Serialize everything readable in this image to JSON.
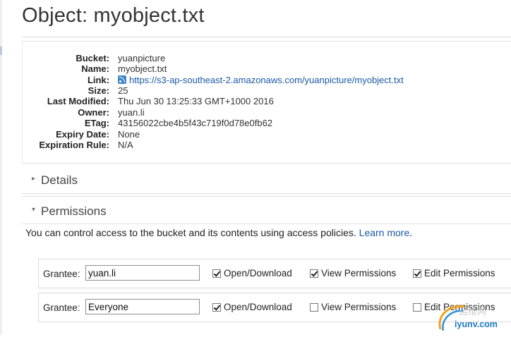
{
  "page": {
    "title": "Object: myobject.txt"
  },
  "properties": [
    {
      "label": "Bucket:",
      "value": "yuanpicture"
    },
    {
      "label": "Name:",
      "value": "myobject.txt"
    },
    {
      "label": "Link:",
      "value": "https://s3-ap-southeast-2.amazonaws.com/yuanpicture/myobject.txt",
      "is_link": true
    },
    {
      "label": "Size:",
      "value": "25"
    },
    {
      "label": "Last Modified:",
      "value": "Thu Jun 30 13:25:33 GMT+1000 2016"
    },
    {
      "label": "Owner:",
      "value": "yuan.li"
    },
    {
      "label": "ETag:",
      "value": "43156022cbe4b5f43c719f0d78e0fb62"
    },
    {
      "label": "Expiry Date:",
      "value": "None"
    },
    {
      "label": "Expiration Rule:",
      "value": "N/A"
    }
  ],
  "sections": {
    "details": {
      "label": "Details",
      "chevron": "▸"
    },
    "permissions": {
      "label": "Permissions",
      "chevron": "▾"
    }
  },
  "permissions": {
    "description": "You can control access to the bucket and its contents using access policies.",
    "learn_more": "Learn more",
    "period": ".",
    "grantee_label": "Grantee:",
    "grantees": [
      {
        "name": "yuan.li",
        "open_download": {
          "label": "Open/Download",
          "checked": true
        },
        "view_permissions": {
          "label": "View Permissions",
          "checked": true
        },
        "edit_permissions": {
          "label": "Edit Permissions",
          "checked": true
        }
      },
      {
        "name": "Everyone",
        "open_download": {
          "label": "Open/Download",
          "checked": true
        },
        "view_permissions": {
          "label": "View Permissions",
          "checked": false
        },
        "edit_permissions": {
          "label": "Edit Permissions",
          "checked": false
        }
      }
    ]
  },
  "watermark": {
    "text": "iyunv.com",
    "cn": "运维网"
  },
  "colors": {
    "link": "#1a5aa6",
    "border": "#dcdcdc"
  }
}
